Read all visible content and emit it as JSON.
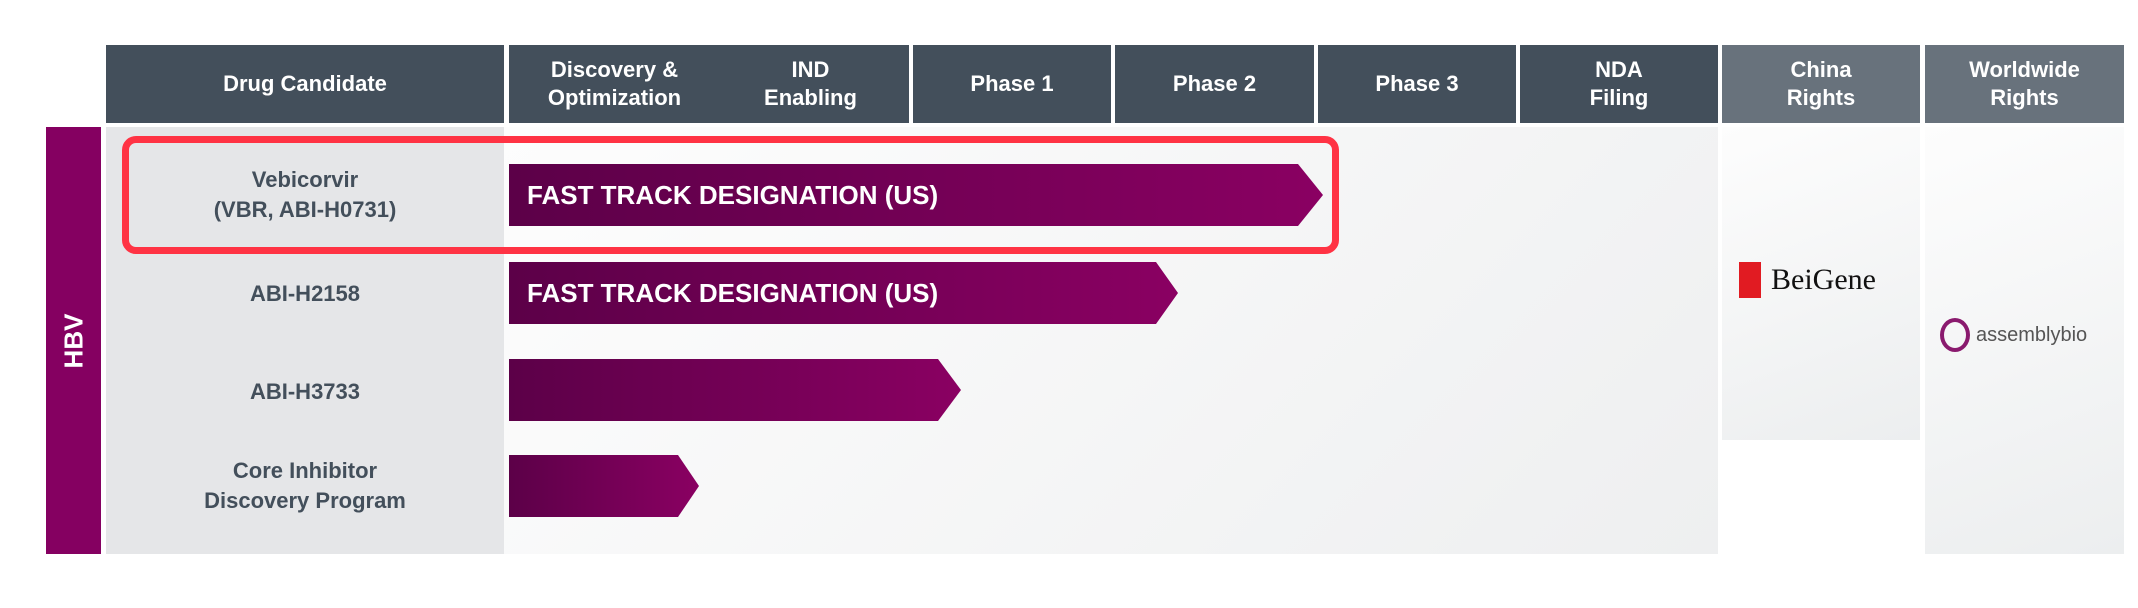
{
  "header": {
    "columns": [
      "Drug Candidate",
      "Discovery & Optimization",
      "IND Enabling",
      "Phase 1",
      "Phase 2",
      "Phase 3",
      "NDA Filing",
      "China Rights",
      "Worldwide Rights"
    ]
  },
  "therapeutic_area": "HBV",
  "rows": [
    {
      "name": "Vebicorvir",
      "name2": "(VBR, ABI-H0731)",
      "bar_label": "FAST TRACK DESIGNATION (US)",
      "highlighted": true
    },
    {
      "name": "ABI-H2158",
      "bar_label": "FAST TRACK DESIGNATION (US)"
    },
    {
      "name": "ABI-H3733",
      "bar_label": ""
    },
    {
      "name": "Core Inhibitor",
      "name2": "Discovery Program",
      "bar_label": ""
    }
  ],
  "partners": {
    "china": "BeiGene",
    "worldwide": "assemblybio"
  },
  "colors": {
    "header": "#434f5b",
    "rights_header": "#68727c",
    "bar": "#850061",
    "highlight": "#ff3344"
  }
}
